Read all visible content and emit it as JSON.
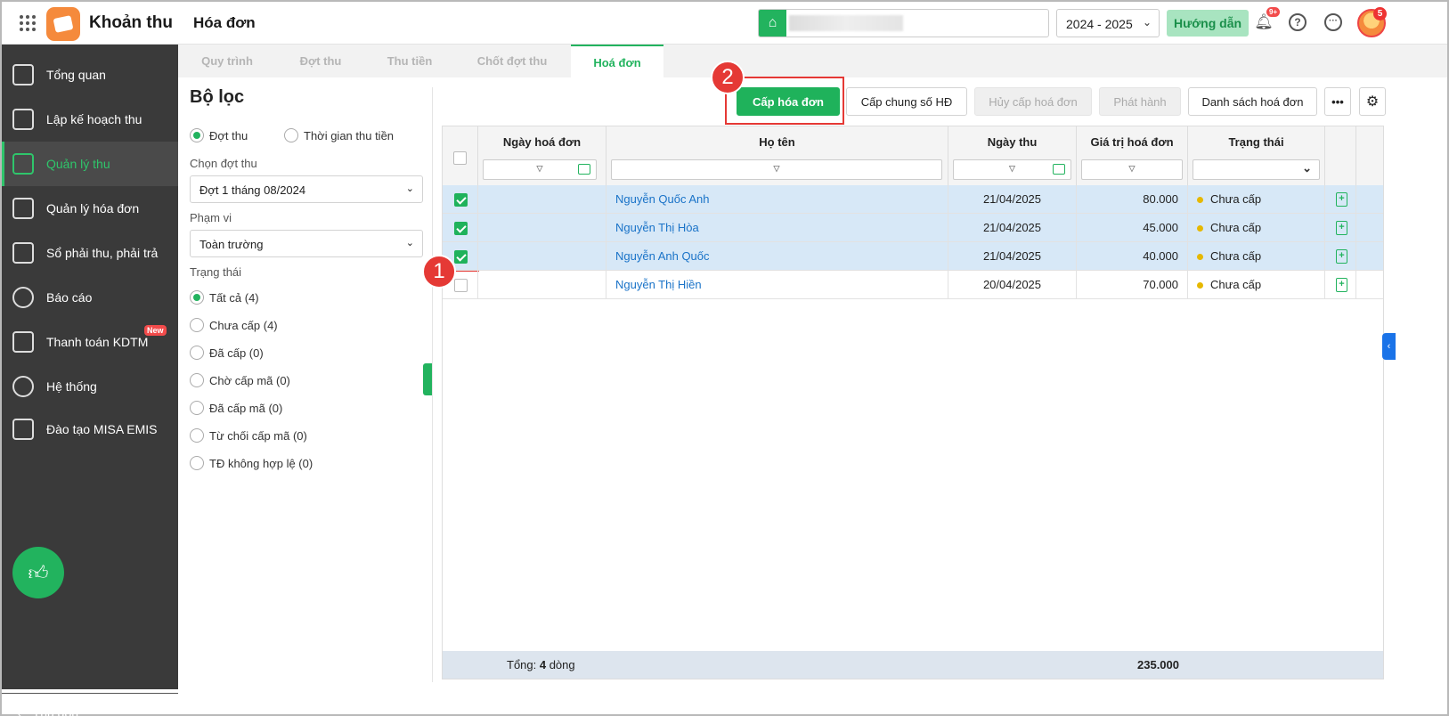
{
  "app": {
    "title": "Khoản thu",
    "page_title": "Hóa đơn"
  },
  "header": {
    "year": "2024 - 2025",
    "guide_label": "Hướng dẫn",
    "notif_count": "9+",
    "avatar_count": "5"
  },
  "sidebar": {
    "items": [
      {
        "label": "Tổng quan",
        "icon": "chart-bars-icon"
      },
      {
        "label": "Lập kế hoạch thu",
        "icon": "calendar-money-icon"
      },
      {
        "label": "Quản lý thu",
        "icon": "hand-coin-icon"
      },
      {
        "label": "Quản lý hóa đơn",
        "icon": "document-icon"
      },
      {
        "label": "Sổ phải thu, phải trả",
        "icon": "ledger-icon"
      },
      {
        "label": "Báo cáo",
        "icon": "pie-chart-icon"
      },
      {
        "label": "Thanh toán KDTM",
        "icon": "card-check-icon"
      },
      {
        "label": "Hệ thống",
        "icon": "gear-icon"
      },
      {
        "label": "Đào tạo MISA EMIS",
        "icon": "book-icon"
      }
    ],
    "new_badge": "New",
    "collapse_label": "Thu gọn"
  },
  "tabs": [
    "Quy trình",
    "Đợt thu",
    "Thu tiền",
    "Chốt đợt thu",
    "Hoá đơn"
  ],
  "filter": {
    "title": "Bộ lọc",
    "mode_options": [
      "Đợt thu",
      "Thời gian thu tiền"
    ],
    "batch_label": "Chọn đợt thu",
    "batch_value": "Đợt 1 tháng 08/2024",
    "scope_label": "Phạm vi",
    "scope_value": "Toàn trường",
    "status_label": "Trạng thái",
    "status_options": [
      "Tất cả (4)",
      "Chưa cấp (4)",
      "Đã cấp (0)",
      "Chờ cấp mã (0)",
      "Đã cấp mã (0)",
      "Từ chối cấp mã (0)",
      "TĐ không hợp lệ (0)"
    ]
  },
  "toolbar": {
    "issue": "Cấp hóa đơn",
    "issue_common": "Cấp chung số HĐ",
    "cancel_issue": "Hủy cấp hoá đơn",
    "publish": "Phát hành",
    "invoice_list": "Danh sách hoá đơn"
  },
  "steps": [
    "1",
    "2"
  ],
  "table": {
    "columns": [
      "Ngày hoá đơn",
      "Họ tên",
      "Ngày thu",
      "Giá trị hoá đơn",
      "Trạng thái"
    ],
    "rows": [
      {
        "invoice_date": "",
        "name": "Nguyễn Quốc Anh",
        "pay_date": "21/04/2025",
        "amount": "80.000",
        "status": "Chưa cấp",
        "selected": true
      },
      {
        "invoice_date": "",
        "name": "Nguyễn Thị Hòa",
        "pay_date": "21/04/2025",
        "amount": "45.000",
        "status": "Chưa cấp",
        "selected": true
      },
      {
        "invoice_date": "",
        "name": "Nguyễn Anh Quốc",
        "pay_date": "21/04/2025",
        "amount": "40.000",
        "status": "Chưa cấp",
        "selected": true
      },
      {
        "invoice_date": "",
        "name": "Nguyễn Thị Hiền",
        "pay_date": "20/04/2025",
        "amount": "70.000",
        "status": "Chưa cấp",
        "selected": false
      }
    ],
    "footer_prefix": "Tổng: ",
    "footer_count": "4",
    "footer_suffix": " dòng",
    "footer_total": "235.000"
  },
  "colors": {
    "accent": "#1fb25b",
    "highlight": "#e53935",
    "link": "#1a73c8",
    "sidebar": "#3a3a3a"
  }
}
